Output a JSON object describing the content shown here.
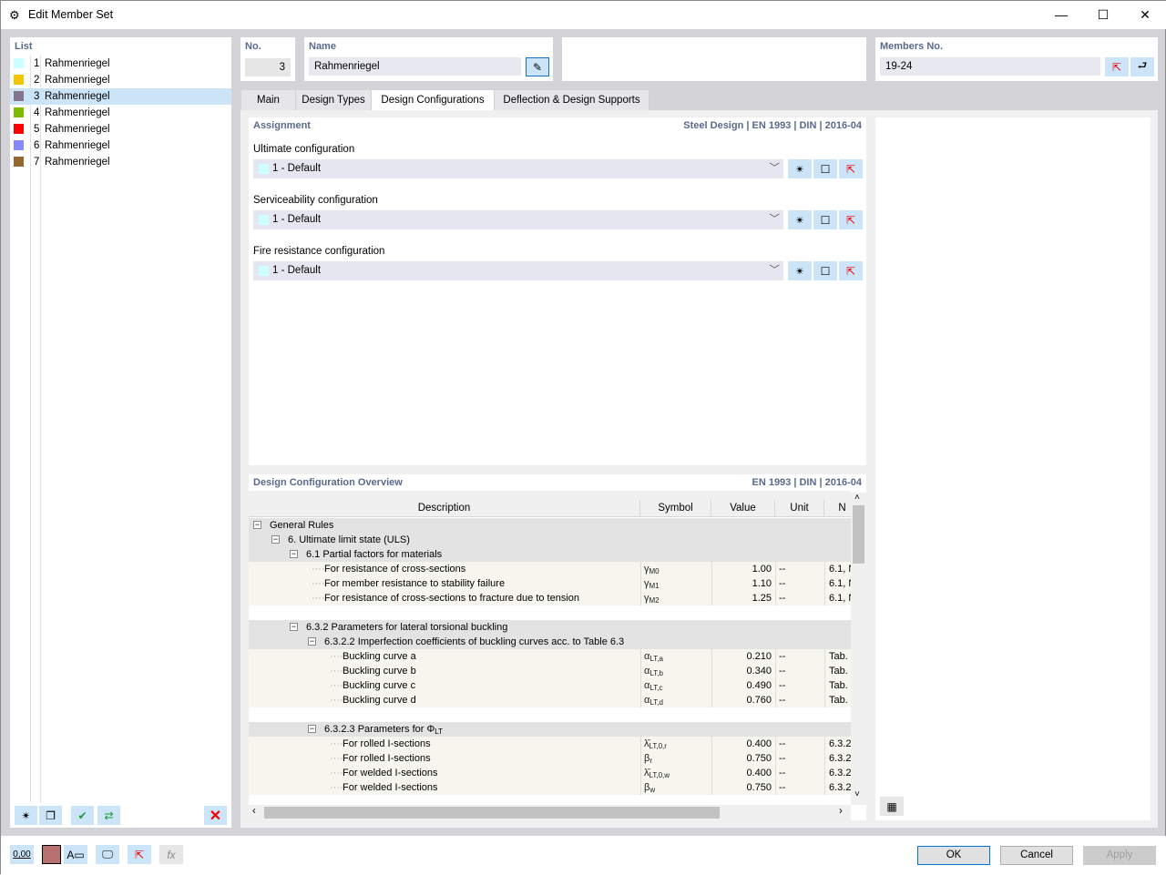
{
  "window": {
    "title": "Edit Member Set",
    "minimize": "—",
    "maximize": "☐",
    "close": "✕"
  },
  "list": {
    "header": "List",
    "items": [
      {
        "no": "1",
        "name": "Rahmenriegel",
        "color": "#ccffff"
      },
      {
        "no": "2",
        "name": "Rahmenriegel",
        "color": "#f5c400"
      },
      {
        "no": "3",
        "name": "Rahmenriegel",
        "color": "#84758f",
        "selected": true
      },
      {
        "no": "4",
        "name": "Rahmenriegel",
        "color": "#7dbb00"
      },
      {
        "no": "5",
        "name": "Rahmenriegel",
        "color": "#ff0000"
      },
      {
        "no": "6",
        "name": "Rahmenriegel",
        "color": "#8888ff"
      },
      {
        "no": "7",
        "name": "Rahmenriegel",
        "color": "#93672f"
      }
    ]
  },
  "no": {
    "label": "No.",
    "value": "3"
  },
  "name": {
    "label": "Name",
    "value": "Rahmenriegel"
  },
  "members": {
    "label": "Members No.",
    "value": "19-24"
  },
  "tabs": [
    "Main",
    "Design Types",
    "Design Configurations",
    "Deflection & Design Supports"
  ],
  "assignment": {
    "title": "Assignment",
    "standard": "Steel Design | EN 1993 | DIN | 2016-04",
    "configs": [
      {
        "label": "Ultimate configuration",
        "value": "1 - Default"
      },
      {
        "label": "Serviceability configuration",
        "value": "1 - Default"
      },
      {
        "label": "Fire resistance configuration",
        "value": "1 - Default"
      }
    ]
  },
  "overview": {
    "title": "Design Configuration Overview",
    "standard": "EN 1993 | DIN | 2016-04",
    "columns": [
      "Description",
      "Symbol",
      "Value",
      "Unit",
      "N"
    ],
    "rows": [
      {
        "t": "g",
        "lvl": 0,
        "d": "General Rules"
      },
      {
        "t": "g",
        "lvl": 1,
        "d": "6. Ultimate limit state (ULS)"
      },
      {
        "t": "g",
        "lvl": 2,
        "d": "6.1 Partial factors for materials"
      },
      {
        "t": "i",
        "lvl": 3,
        "d": "For resistance of cross-sections",
        "s": "γ",
        "sub": "M0",
        "v": "1.00",
        "u": "--",
        "n": "6.1, N"
      },
      {
        "t": "i",
        "lvl": 3,
        "d": "For member resistance to stability failure",
        "s": "γ",
        "sub": "M1",
        "v": "1.10",
        "u": "--",
        "n": "6.1, N"
      },
      {
        "t": "i",
        "lvl": 3,
        "d": "For resistance of cross-sections to fracture due to tension",
        "s": "γ",
        "sub": "M2",
        "v": "1.25",
        "u": "--",
        "n": "6.1, N"
      },
      {
        "t": "e"
      },
      {
        "t": "g",
        "lvl": 2,
        "d": "6.3.2 Parameters for lateral torsional buckling"
      },
      {
        "t": "g",
        "lvl": 3,
        "d": "6.3.2.2 Imperfection coefficients of buckling curves acc. to Table 6.3"
      },
      {
        "t": "i",
        "lvl": 4,
        "d": "Buckling curve a",
        "s": "α",
        "sub": "LT,a",
        "v": "0.210",
        "u": "--",
        "n": "Tab."
      },
      {
        "t": "i",
        "lvl": 4,
        "d": "Buckling curve b",
        "s": "α",
        "sub": "LT,b",
        "v": "0.340",
        "u": "--",
        "n": "Tab."
      },
      {
        "t": "i",
        "lvl": 4,
        "d": "Buckling curve c",
        "s": "α",
        "sub": "LT,c",
        "v": "0.490",
        "u": "--",
        "n": "Tab."
      },
      {
        "t": "i",
        "lvl": 4,
        "d": "Buckling curve d",
        "s": "α",
        "sub": "LT,d",
        "v": "0.760",
        "u": "--",
        "n": "Tab."
      },
      {
        "t": "e"
      },
      {
        "t": "g",
        "lvl": 3,
        "d": "6.3.2.3 Parameters for Φ",
        "dsub": "LT"
      },
      {
        "t": "i",
        "lvl": 4,
        "d": "For rolled I-sections",
        "s": "λ̄",
        "sub": "LT,0,r",
        "v": "0.400",
        "u": "--",
        "n": "6.3.2"
      },
      {
        "t": "i",
        "lvl": 4,
        "d": "For rolled I-sections",
        "s": "β",
        "sub": "r",
        "v": "0.750",
        "u": "--",
        "n": "6.3.2"
      },
      {
        "t": "i",
        "lvl": 4,
        "d": "For welded I-sections",
        "s": "λ̄",
        "sub": "LT,0,w",
        "v": "0.400",
        "u": "--",
        "n": "6.3.2"
      },
      {
        "t": "i",
        "lvl": 4,
        "d": "For welded I-sections",
        "s": "β",
        "sub": "w",
        "v": "0.750",
        "u": "--",
        "n": "6.3.2"
      }
    ]
  },
  "footer": {
    "units": "0,00",
    "ok": "OK",
    "cancel": "Cancel",
    "apply": "Apply"
  }
}
